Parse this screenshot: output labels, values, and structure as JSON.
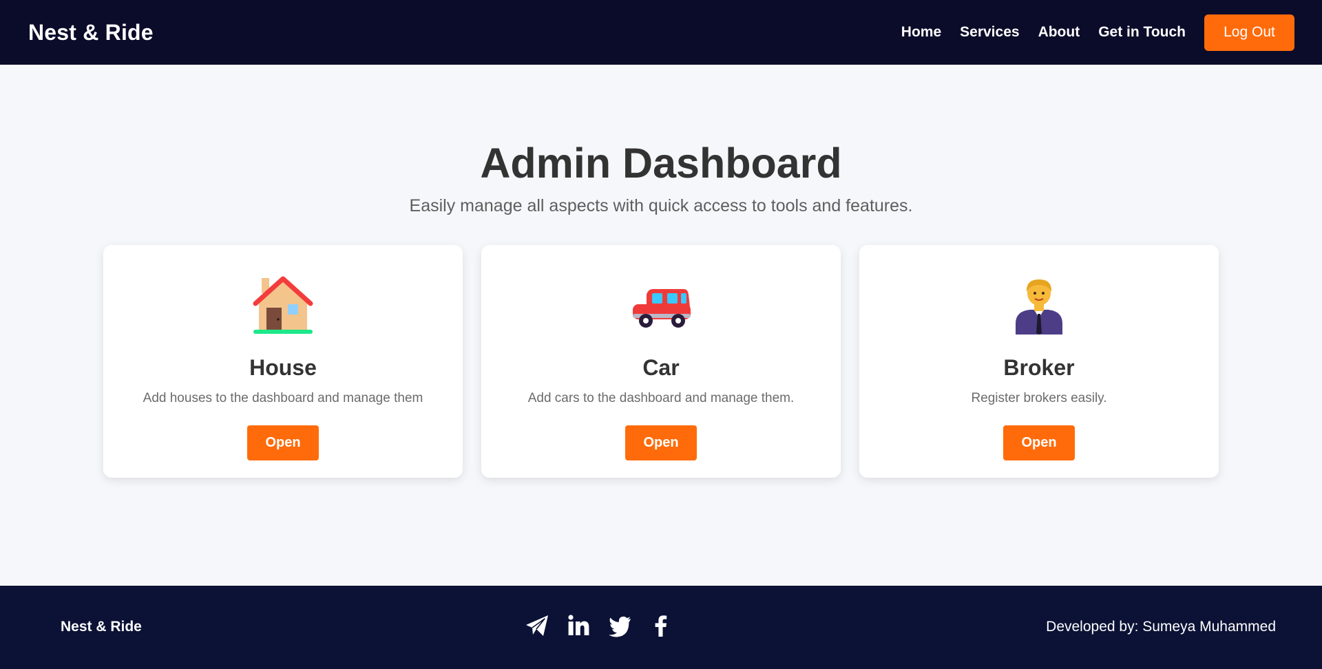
{
  "header": {
    "brand": "Nest & Ride",
    "nav": [
      "Home",
      "Services",
      "About",
      "Get in Touch"
    ],
    "logout_label": "Log Out"
  },
  "main": {
    "title": "Admin Dashboard",
    "subtitle": "Easily manage all aspects with quick access to tools and features.",
    "cards": [
      {
        "icon": "house-icon",
        "title": "House",
        "description": "Add houses to the dashboard and manage them",
        "button": "Open"
      },
      {
        "icon": "car-icon",
        "title": "Car",
        "description": "Add cars to the dashboard and manage them.",
        "button": "Open"
      },
      {
        "icon": "broker-icon",
        "title": "Broker",
        "description": "Register brokers easily.",
        "button": "Open"
      }
    ]
  },
  "footer": {
    "brand": "Nest & Ride",
    "socials": [
      "telegram-icon",
      "linkedin-icon",
      "twitter-icon",
      "facebook-icon"
    ],
    "developer": "Developed by: Sumeya Muhammed"
  },
  "colors": {
    "header_bg": "#0b0b2a",
    "footer_bg": "#0b1235",
    "accent": "#ff6b0a",
    "page_bg": "#f6f7fa"
  }
}
